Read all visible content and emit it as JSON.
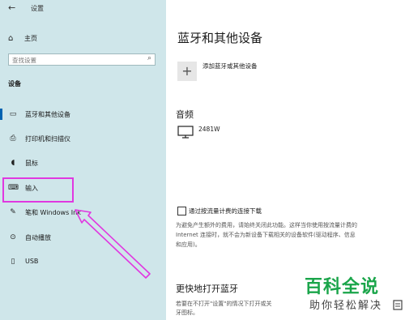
{
  "window": {
    "title": "设置",
    "back_icon": "back-arrow-icon"
  },
  "sidebar": {
    "home_label": "主页",
    "search_placeholder": "查找设置",
    "section_label": "设备",
    "items": [
      {
        "label": "蓝牙和其他设备",
        "icon": "bluetooth-devices-icon",
        "selected": true
      },
      {
        "label": "打印机和扫描仪",
        "icon": "printer-icon",
        "selected": false
      },
      {
        "label": "鼠标",
        "icon": "mouse-icon",
        "selected": false
      },
      {
        "label": "输入",
        "icon": "keyboard-icon",
        "selected": false
      },
      {
        "label": "笔和 Windows Ink",
        "icon": "pen-icon",
        "selected": false
      },
      {
        "label": "自动播放",
        "icon": "autoplay-icon",
        "selected": false
      },
      {
        "label": "USB",
        "icon": "usb-icon",
        "selected": false
      }
    ]
  },
  "main": {
    "title": "蓝牙和其他设备",
    "add_device_label": "添加蓝牙或其他设备",
    "audio_title": "音频",
    "audio_device": "2481W",
    "metered_label": "通过按流量计费的连接下载",
    "metered_desc_line1": "为避免产生额外的费用，请始终关闭此功能。这样当你使用按流量计费的",
    "metered_desc_line2": "Internet 连接时，就不会为新设备下载相关的设备软件(驱动程序、信息",
    "metered_desc_line3": "和应用)。",
    "open_bt_title": "更快地打开蓝牙",
    "open_bt_desc_line1": "若要在不打开\"设置\"的情况下打开或关",
    "open_bt_desc_line2": "牙图标。"
  },
  "watermark": {
    "big": "百科全说",
    "small": "助你轻松解决"
  },
  "colors": {
    "sidebar_bg": "#cfe6ea",
    "accent": "#0063b1",
    "annotation": "#e038e0",
    "watermark": "#1aa54a"
  }
}
